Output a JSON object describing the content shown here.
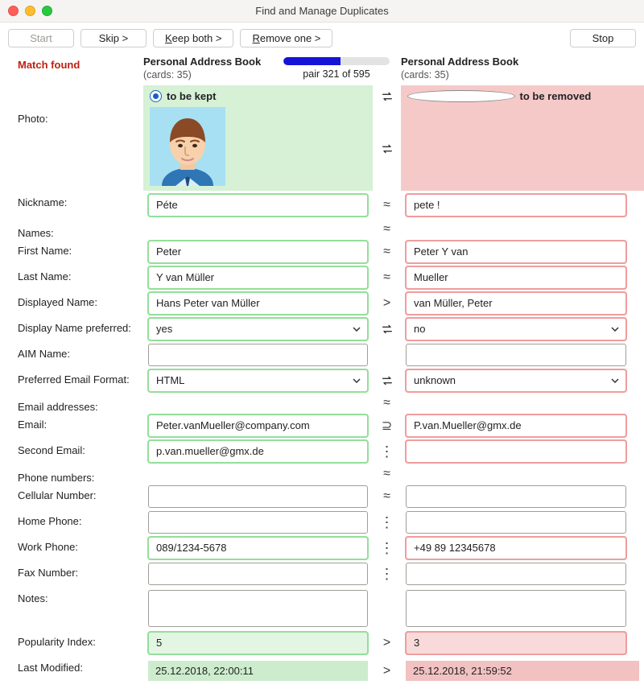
{
  "window": {
    "title": "Find and Manage Duplicates"
  },
  "toolbar": {
    "start": "Start",
    "skip": "Skip >",
    "keep_pre": "K",
    "keep_post": "eep both >",
    "remove_pre": "R",
    "remove_post": "emove one >",
    "stop": "Stop"
  },
  "status": {
    "match_found": "Match found",
    "progress_pct": 54,
    "pair_text": "pair 321 of 595"
  },
  "left_book": {
    "title": "Personal Address Book",
    "cards": "(cards: 35)"
  },
  "right_book": {
    "title": "Personal Address Book",
    "cards": "(cards: 35)"
  },
  "choice": {
    "keep": "to be kept",
    "remove": "to be removed"
  },
  "labels": {
    "photo": "Photo:",
    "nickname": "Nickname:",
    "names": "Names:",
    "first": "First Name:",
    "last": "Last Name:",
    "displayed": "Displayed Name:",
    "dispPref": "Display Name preferred:",
    "aim": "AIM Name:",
    "emailFmt": "Preferred Email Format:",
    "emails": "Email addresses:",
    "email": "Email:",
    "email2": "Second Email:",
    "phones": "Phone numbers:",
    "cell": "Cellular Number:",
    "home": "Home Phone:",
    "work": "Work Phone:",
    "fax": "Fax Number:",
    "notes": "Notes:",
    "pop": "Popularity Index:",
    "lastmod": "Last Modified:"
  },
  "left": {
    "nickname": "Péte",
    "first": "Peter",
    "last": "Y  van Müller",
    "displayed": "Hans Peter van Müller",
    "dispPref": "yes",
    "aim": "",
    "emailFmt": "HTML",
    "email": "Peter.vanMueller@company.com",
    "email2": "p.van.mueller@gmx.de",
    "cell": "",
    "home": "",
    "work": "089/1234-5678",
    "fax": "",
    "notes": "",
    "pop": "5",
    "lastmod": "25.12.2018, 22:00:11"
  },
  "right": {
    "nickname": "pete !",
    "first": "Peter Y van",
    "last": "Mueller",
    "displayed": "van Müller, Peter",
    "dispPref": "no",
    "aim": "",
    "emailFmt": "unknown",
    "email": "P.van.Mueller@gmx.de",
    "email2": "",
    "cell": "",
    "home": "",
    "work": "+49 89 12345678",
    "fax": "",
    "notes": "",
    "pop": "3",
    "lastmod": "25.12.2018, 21:59:52"
  }
}
